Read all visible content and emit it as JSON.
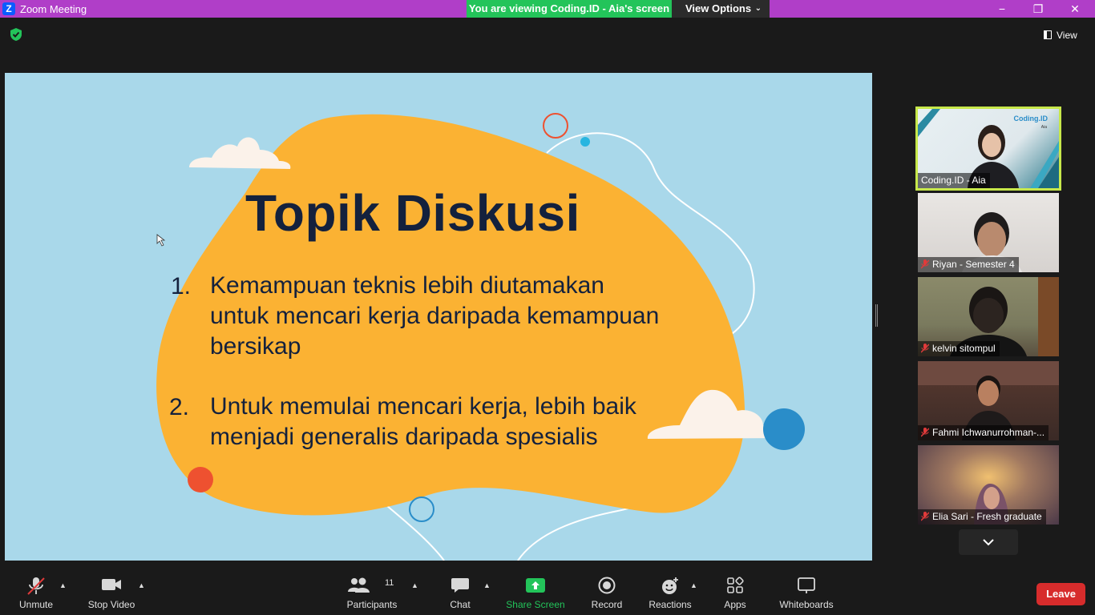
{
  "window": {
    "app_logo": "Z",
    "title": "Zoom Meeting",
    "viewing_banner": "You are viewing Coding.ID - Aia's screen",
    "view_options": "View Options",
    "controls": {
      "minimize": "−",
      "restore": "❐",
      "close": "✕"
    }
  },
  "topbar": {
    "view_label": "View"
  },
  "slide": {
    "title": "Topik Diskusi",
    "items": [
      {
        "num": "1.",
        "lines": [
          "Kemampuan teknis lebih diutamakan",
          "untuk mencari kerja daripada kemampuan",
          "bersikap"
        ]
      },
      {
        "num": "2.",
        "lines": [
          "Untuk memulai mencari kerja, lebih baik",
          "menjadi generalis daripada spesialis"
        ]
      }
    ],
    "colors": {
      "background": "#a9d8ea",
      "blob": "#fbb233",
      "text": "#14213d",
      "accent_red": "#ee5130",
      "accent_blue": "#2a8dc9"
    }
  },
  "participants": [
    {
      "name": "Coding.ID - Aia",
      "muted": false,
      "active": true,
      "logo": "Coding.ID",
      "logo_sub": "Aia"
    },
    {
      "name": "Riyan - Semester 4",
      "muted": true
    },
    {
      "name": "kelvin sitompul",
      "muted": true
    },
    {
      "name": "Fahmi Ichwanurrohman-...",
      "muted": true
    },
    {
      "name": "Elia Sari - Fresh graduate",
      "muted": true
    }
  ],
  "toolbar": {
    "unmute": "Unmute",
    "stop_video": "Stop Video",
    "participants": "Participants",
    "participants_count": "11",
    "chat": "Chat",
    "share_screen": "Share Screen",
    "record": "Record",
    "reactions": "Reactions",
    "apps": "Apps",
    "whiteboards": "Whiteboards",
    "leave": "Leave"
  }
}
